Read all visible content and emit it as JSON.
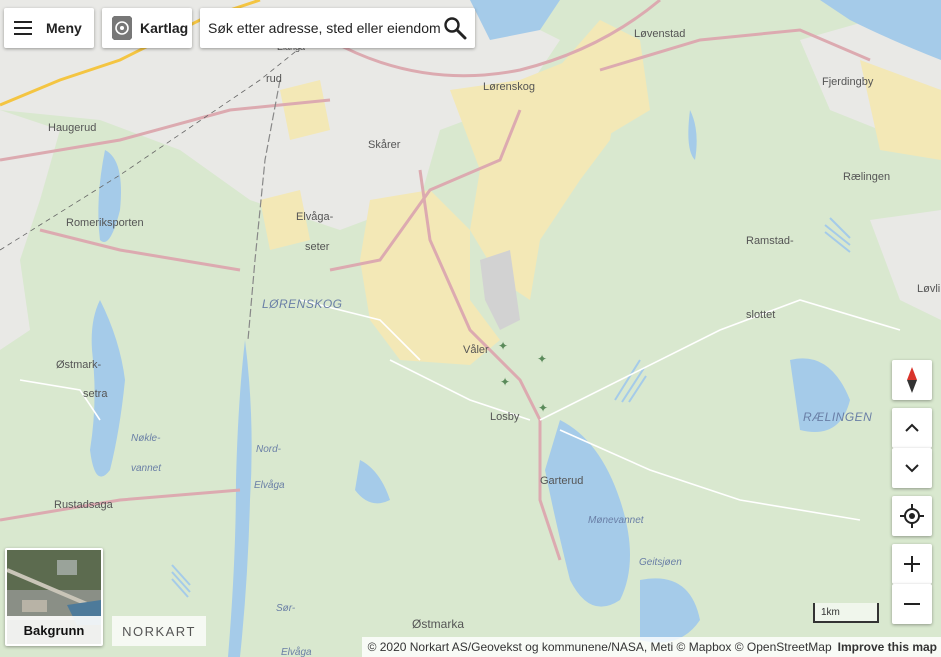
{
  "toolbar": {
    "menu_label": "Meny",
    "layers_label": "Kartlag",
    "search_placeholder": "Søk etter adresse, sted eller eiendom"
  },
  "background_switch": {
    "label": "Bakgrunn"
  },
  "logo": {
    "text": "NORKART"
  },
  "scale": {
    "text": "1km"
  },
  "attribution": {
    "text": "© 2020 Norkart AS/Geovekst og kommunene/NASA, Meti © Mapbox © OpenStreetMap",
    "improve_link": "Improve this map"
  },
  "colors": {
    "forest": "#d9e8cf",
    "urban": "#e9e9e6",
    "farmland": "#f3e8b6",
    "water": "#a5cbe9",
    "road": "#dcaab0",
    "label": "#555555",
    "area_label": "#6a7fa6"
  },
  "map_labels": {
    "lovenstad": "Løvenstad",
    "lorenskog_town": "Lørenskog",
    "fjerdingby": "Fjerdingby",
    "haugerud": "Haugerud",
    "skarer": "Skårer",
    "rud": "rud",
    "elvaga_a": "Elvåga-",
    "elvaga_b": "seter",
    "romeriksporten": "Romeriksporten",
    "ralingen_town": "Rælingen",
    "ramstad": "Ramstad-",
    "slottet": "slottet",
    "lovli": "Løvli",
    "lorenskog_area": "LØRENSKOG",
    "valer": "Våler",
    "ostmark_a": "Østmark-",
    "ostmark_b": "setra",
    "losby": "Losby",
    "ralingen_area": "RÆLINGEN",
    "nokle_a": "Nøkle-",
    "nokle_b": "vannet",
    "nord_a": "Nord-",
    "nord_b": "Elvåga",
    "garterud": "Garterud",
    "monevannet": "Mønevannet",
    "rustadsaga": "Rustadsaga",
    "geitsjoen": "Geitsjøen",
    "sor": "Sør-",
    "ostmarka": "Østmarka",
    "elvaga_bottom": "Elvåga",
    "elanga": "Elanga"
  }
}
